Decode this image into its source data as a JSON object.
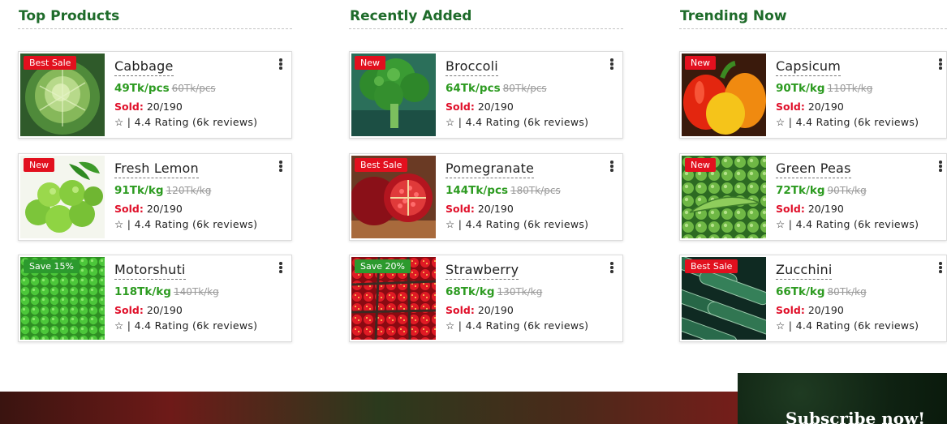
{
  "columns": [
    {
      "title": "Top Products",
      "products": [
        {
          "badge": "Best Sale",
          "badge_color": "#e2101e",
          "name": "Cabbage",
          "price": "49Tk/pcs",
          "old_price": "60Tk/pcs",
          "sold_label": "Sold:",
          "sold": "20/190",
          "rating": "☆ | 4.4 Rating (6k reviews)",
          "icon": "cabbage-image"
        },
        {
          "badge": "New",
          "badge_color": "#e2101e",
          "name": "Fresh Lemon",
          "price": "91Tk/kg",
          "old_price": "120Tk/kg",
          "sold_label": "Sold:",
          "sold": "20/190",
          "rating": "☆ | 4.4 Rating (6k reviews)",
          "icon": "lemon-image"
        },
        {
          "badge": "Save 15%",
          "badge_color": "#2c9a2e",
          "name": "Motorshuti",
          "price": "118Tk/kg",
          "old_price": "140Tk/kg",
          "sold_label": "Sold:",
          "sold": "20/190",
          "rating": "☆ | 4.4 Rating (6k reviews)",
          "icon": "peas-image"
        }
      ]
    },
    {
      "title": "Recently Added",
      "products": [
        {
          "badge": "New",
          "badge_color": "#e2101e",
          "name": "Broccoli",
          "price": "64Tk/pcs",
          "old_price": "80Tk/pcs",
          "sold_label": "Sold:",
          "sold": "20/190",
          "rating": "☆ | 4.4 Rating (6k reviews)",
          "icon": "broccoli-image"
        },
        {
          "badge": "Best Sale",
          "badge_color": "#e2101e",
          "name": "Pomegranate",
          "price": "144Tk/pcs",
          "old_price": "180Tk/pcs",
          "sold_label": "Sold:",
          "sold": "20/190",
          "rating": "☆ | 4.4 Rating (6k reviews)",
          "icon": "pomegranate-image"
        },
        {
          "badge": "Save 20%",
          "badge_color": "#2c9a2e",
          "name": "Strawberry",
          "price": "68Tk/kg",
          "old_price": "130Tk/kg",
          "sold_label": "Sold:",
          "sold": "20/190",
          "rating": "☆ | 4.4 Rating (6k reviews)",
          "icon": "strawberry-image"
        }
      ]
    },
    {
      "title": "Trending Now",
      "products": [
        {
          "badge": "New",
          "badge_color": "#e2101e",
          "name": "Capsicum",
          "price": "90Tk/kg",
          "old_price": "110Tk/kg",
          "sold_label": "Sold:",
          "sold": "20/190",
          "rating": "☆ | 4.4 Rating (6k reviews)",
          "icon": "capsicum-image"
        },
        {
          "badge": "New",
          "badge_color": "#e2101e",
          "name": "Green Peas",
          "price": "72Tk/kg",
          "old_price": "90Tk/kg",
          "sold_label": "Sold:",
          "sold": "20/190",
          "rating": "☆ | 4.4 Rating (6k reviews)",
          "icon": "green-peas-image"
        },
        {
          "badge": "Best Sale",
          "badge_color": "#e2101e",
          "name": "Zucchini",
          "price": "66Tk/kg",
          "old_price": "80Tk/kg",
          "sold_label": "Sold:",
          "sold": "20/190",
          "rating": "☆ | 4.4 Rating (6k reviews)",
          "icon": "zucchini-image"
        }
      ]
    }
  ],
  "subscribe": {
    "title": "Subscribe now!"
  }
}
